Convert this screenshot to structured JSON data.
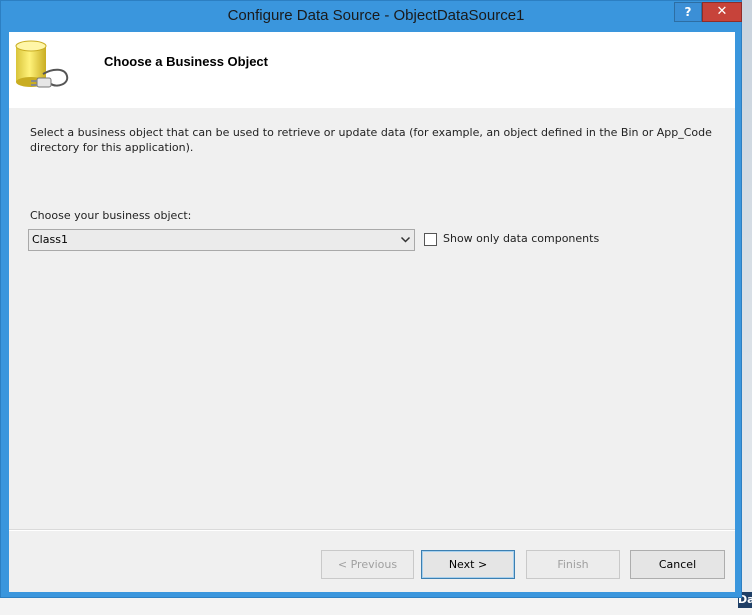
{
  "window": {
    "title": "Configure Data Source - ObjectDataSource1",
    "help_label": "?",
    "close_label": "✕"
  },
  "header": {
    "title": "Choose a Business Object",
    "icon": "database-plug-icon"
  },
  "description": "Select a business object that can be used to retrieve or update data (for example, an object defined in the Bin or App_Code directory for this application).",
  "business_object": {
    "label": "Choose your business object:",
    "selected": "Class1"
  },
  "filter": {
    "label": "Show only data components",
    "checked": false
  },
  "buttons": {
    "previous": "< Previous",
    "next": "Next >",
    "finish": "Finish",
    "cancel": "Cancel"
  },
  "background": {
    "corner_text": "Da"
  },
  "colors": {
    "frame": "#3a96dd",
    "close": "#c7433a",
    "client": "#f0f0f0"
  }
}
